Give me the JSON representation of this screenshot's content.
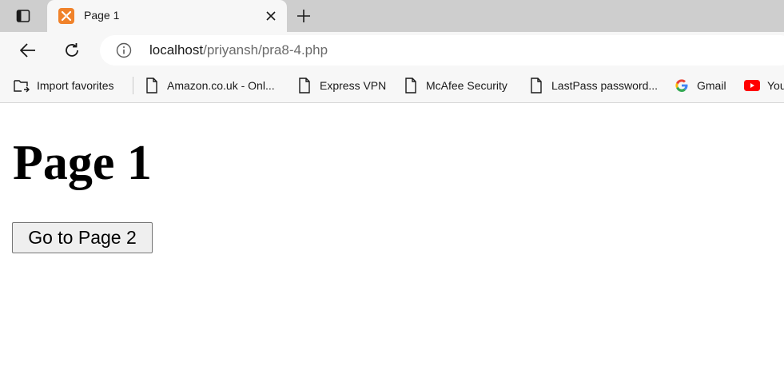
{
  "browser": {
    "tab": {
      "title": "Page 1",
      "favicon": "xampp-icon"
    },
    "address": {
      "host": "localhost",
      "path": "/priyansh/pra8-4.php"
    },
    "favorites": [
      {
        "label": "Import favorites",
        "icon": "import-favorites-icon"
      },
      {
        "label": "Amazon.co.uk - Onl...",
        "icon": "page-icon"
      },
      {
        "label": "Express VPN",
        "icon": "page-icon"
      },
      {
        "label": "McAfee Security",
        "icon": "page-icon"
      },
      {
        "label": "LastPass password...",
        "icon": "page-icon"
      },
      {
        "label": "Gmail",
        "icon": "google-icon"
      },
      {
        "label": "You",
        "icon": "youtube-icon"
      }
    ],
    "colors": {
      "tab_strip": "#cecece",
      "toolbar": "#f7f7f7",
      "favicon": "#f0822a",
      "youtube": "#ff0000"
    }
  },
  "page": {
    "heading": "Page 1",
    "button_label": "Go to Page 2"
  }
}
